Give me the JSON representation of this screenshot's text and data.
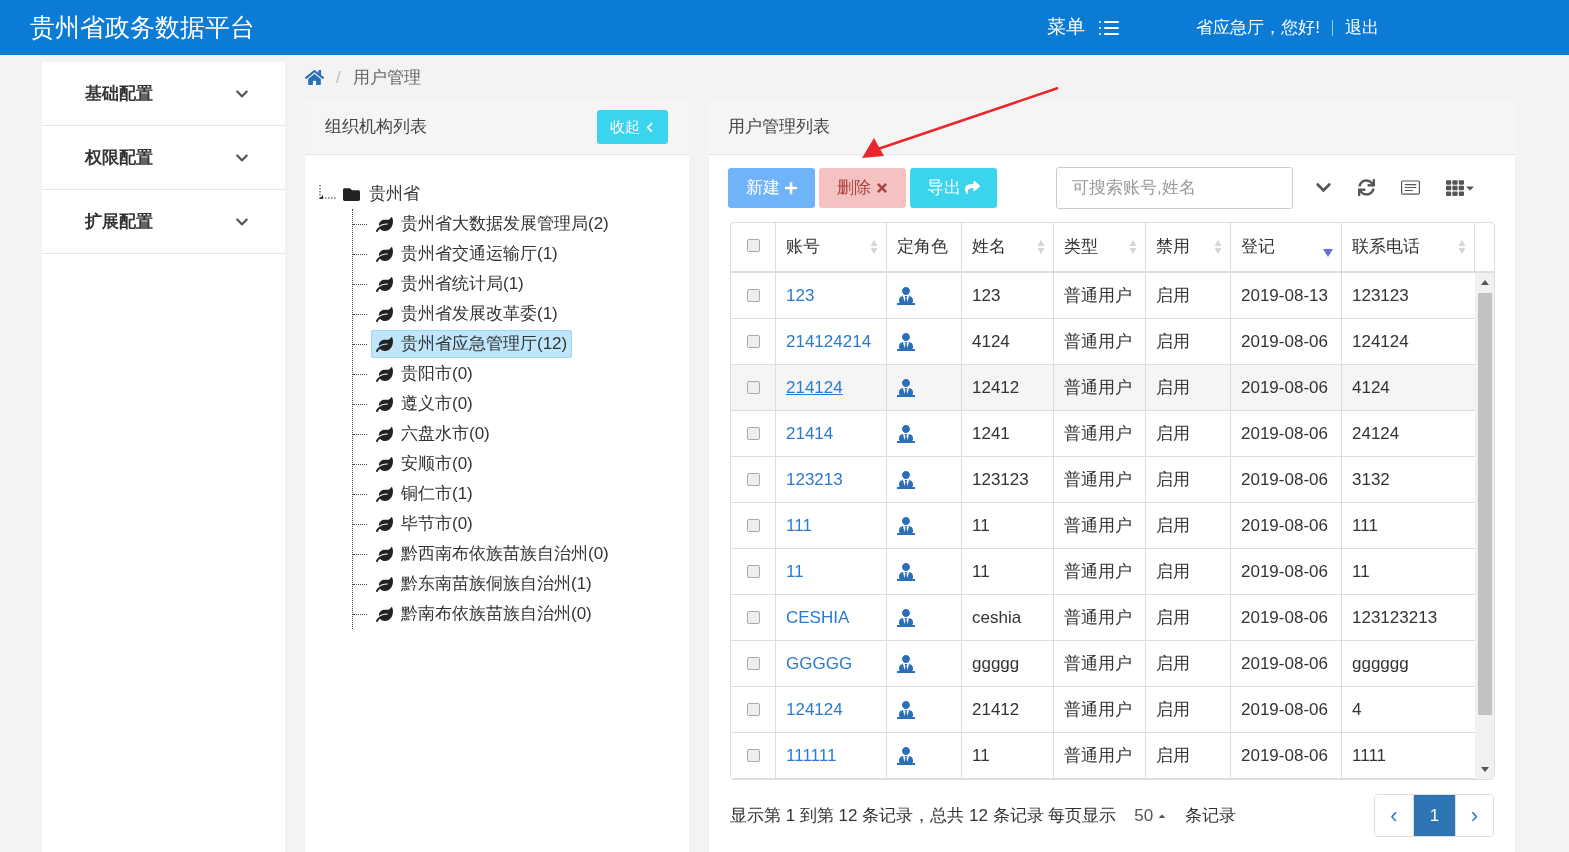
{
  "header": {
    "title": "贵州省政务数据平台",
    "menu_label": "菜单",
    "greeting": "省应急厅，您好!",
    "logout": "退出"
  },
  "sidebar": {
    "items": [
      {
        "label": "基础配置",
        "expanded": false
      },
      {
        "label": "权限配置",
        "expanded": false
      },
      {
        "label": "扩展配置",
        "expanded": false
      }
    ]
  },
  "breadcrumb": {
    "separator": "/",
    "current": "用户管理"
  },
  "org_panel": {
    "title": "组织机构列表",
    "collapse_button": "收起",
    "tree": {
      "label": "贵州省",
      "expanded": true,
      "children": [
        {
          "label": "贵州省大数据发展管理局(2)",
          "selected": false
        },
        {
          "label": "贵州省交通运输厅(1)",
          "selected": false
        },
        {
          "label": "贵州省统计局(1)",
          "selected": false
        },
        {
          "label": "贵州省发展改革委(1)",
          "selected": false
        },
        {
          "label": "贵州省应急管理厅(12)",
          "selected": true
        },
        {
          "label": "贵阳市(0)",
          "selected": false
        },
        {
          "label": "遵义市(0)",
          "selected": false
        },
        {
          "label": "六盘水市(0)",
          "selected": false
        },
        {
          "label": "安顺市(0)",
          "selected": false
        },
        {
          "label": "铜仁市(1)",
          "selected": false
        },
        {
          "label": "毕节市(0)",
          "selected": false
        },
        {
          "label": "黔西南布依族苗族自治州(0)",
          "selected": false
        },
        {
          "label": "黔东南苗族侗族自治州(1)",
          "selected": false
        },
        {
          "label": "黔南布依族苗族自治州(0)",
          "selected": false
        }
      ]
    }
  },
  "user_panel": {
    "title": "用户管理列表",
    "buttons": [
      {
        "label": "新建",
        "kind": "new",
        "disabled": false
      },
      {
        "label": "删除",
        "kind": "delete",
        "disabled": true
      },
      {
        "label": "导出",
        "kind": "export",
        "disabled": false
      }
    ],
    "search": {
      "placeholder": "可搜索账号,姓名"
    },
    "table": {
      "all_checked": false,
      "columns": [
        {
          "label": "账号",
          "sortable": true,
          "sorted": false
        },
        {
          "label": "定角色",
          "sortable": false,
          "sorted": false
        },
        {
          "label": "姓名",
          "sortable": true,
          "sorted": false
        },
        {
          "label": "类型",
          "sortable": true,
          "sorted": false
        },
        {
          "label": "禁用",
          "sortable": true,
          "sorted": false
        },
        {
          "label": "登记",
          "sortable": true,
          "sorted": true
        },
        {
          "label": "联系电话",
          "sortable": true,
          "sorted": false
        }
      ],
      "rows": [
        {
          "checked": false,
          "highlighted": false,
          "account": "123",
          "name": "123",
          "type": "普通用户",
          "disabled": "启用",
          "date": "2019-08-13",
          "phone": "123123"
        },
        {
          "checked": false,
          "highlighted": false,
          "account": "214124214",
          "name": "4124",
          "type": "普通用户",
          "disabled": "启用",
          "date": "2019-08-06",
          "phone": "124124"
        },
        {
          "checked": false,
          "highlighted": true,
          "account": "214124",
          "name": "12412",
          "type": "普通用户",
          "disabled": "启用",
          "date": "2019-08-06",
          "phone": "4124"
        },
        {
          "checked": false,
          "highlighted": false,
          "account": "21414",
          "name": "1241",
          "type": "普通用户",
          "disabled": "启用",
          "date": "2019-08-06",
          "phone": "24124"
        },
        {
          "checked": false,
          "highlighted": false,
          "account": "123213",
          "name": "123123",
          "type": "普通用户",
          "disabled": "启用",
          "date": "2019-08-06",
          "phone": "3132"
        },
        {
          "checked": false,
          "highlighted": false,
          "account": "111",
          "name": "11",
          "type": "普通用户",
          "disabled": "启用",
          "date": "2019-08-06",
          "phone": "111"
        },
        {
          "checked": false,
          "highlighted": false,
          "account": "11",
          "name": "11",
          "type": "普通用户",
          "disabled": "启用",
          "date": "2019-08-06",
          "phone": "11"
        },
        {
          "checked": false,
          "highlighted": false,
          "account": "CESHIA",
          "name": "ceshia",
          "type": "普通用户",
          "disabled": "启用",
          "date": "2019-08-06",
          "phone": "123123213"
        },
        {
          "checked": false,
          "highlighted": false,
          "account": "GGGGG",
          "name": "ggggg",
          "type": "普通用户",
          "disabled": "启用",
          "date": "2019-08-06",
          "phone": "gggggg"
        },
        {
          "checked": false,
          "highlighted": false,
          "account": "124124",
          "name": "21412",
          "type": "普通用户",
          "disabled": "启用",
          "date": "2019-08-06",
          "phone": "4"
        },
        {
          "checked": false,
          "highlighted": false,
          "account": "111111",
          "name": "11",
          "type": "普通用户",
          "disabled": "启用",
          "date": "2019-08-06",
          "phone": "1111"
        }
      ]
    },
    "footer": {
      "summary": "显示第 1 到第 12 条记录，总共 12 条记录 每页显示",
      "page_size": "50",
      "suffix": "条记录",
      "pages": [
        {
          "label": "‹",
          "kind": "prev",
          "selected": false
        },
        {
          "label": "1",
          "kind": "page",
          "selected": true
        },
        {
          "label": "›",
          "kind": "next",
          "selected": false
        }
      ]
    }
  }
}
